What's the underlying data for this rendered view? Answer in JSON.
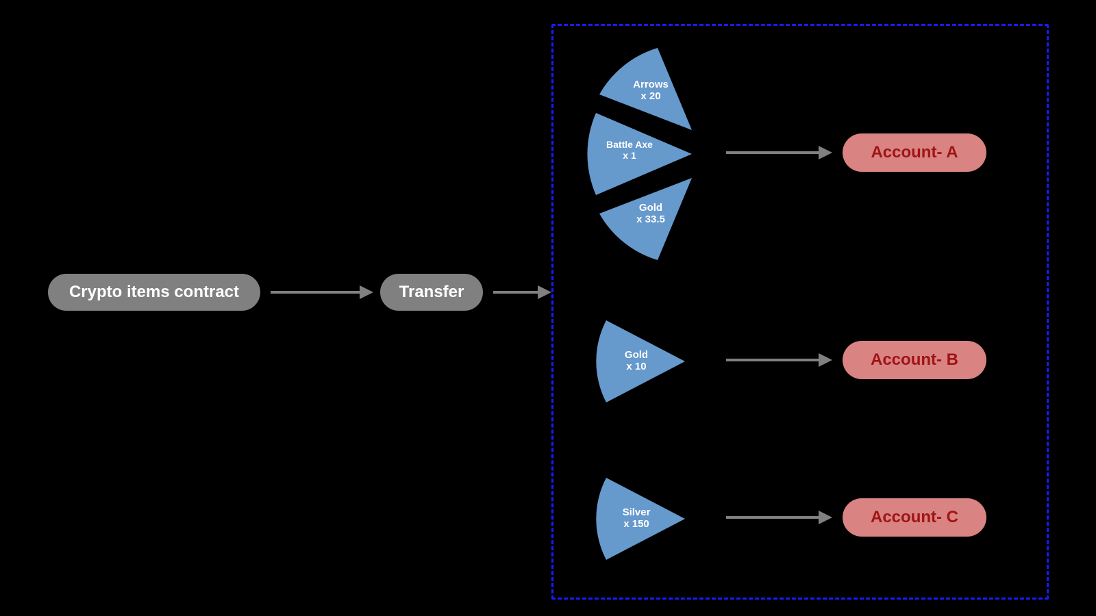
{
  "nodes": {
    "contract": "Crypto items contract",
    "transfer": "Transfer"
  },
  "groups": [
    {
      "account": "Account- A",
      "items": [
        {
          "name": "Arrows",
          "qty": "x 20"
        },
        {
          "name": "Battle Axe",
          "qty": "x 1"
        },
        {
          "name": "Gold",
          "qty": "x 33.5"
        }
      ]
    },
    {
      "account": "Account- B",
      "items": [
        {
          "name": "Gold",
          "qty": "x 10"
        }
      ]
    },
    {
      "account": "Account- C",
      "items": [
        {
          "name": "Silver",
          "qty": "x 150"
        }
      ]
    }
  ],
  "colors": {
    "pill_grey": "#808080",
    "pill_red_bg": "#d98383",
    "pill_red_text": "#a01414",
    "wedge_fill": "#6699cc",
    "dashed_border": "#1a1aff",
    "background": "#000000"
  }
}
